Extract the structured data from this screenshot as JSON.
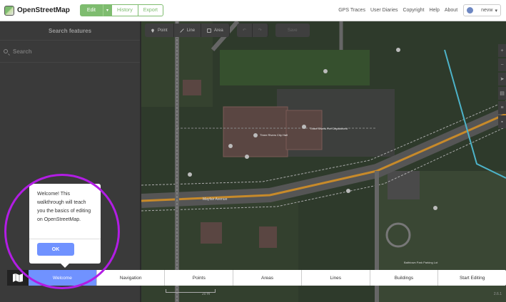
{
  "navbar": {
    "brand": "OpenStreetMap",
    "edit_label": "Edit",
    "history_label": "History",
    "export_label": "Export",
    "links": [
      "GPS Traces",
      "User Diaries",
      "Copyright",
      "Help",
      "About"
    ],
    "username": "nevw"
  },
  "sidebar": {
    "header": "Search features",
    "search_placeholder": "Search"
  },
  "toolbar": {
    "point_label": "Point",
    "line_label": "Line",
    "area_label": "Area",
    "save_label": "Save"
  },
  "map_labels": {
    "street": "Mayfair Avenue",
    "place1": "Three Rivers City Hall",
    "place2": "Three Rivers Fire Department",
    "park": "Bathtown Park Parking Lot"
  },
  "tooltip": {
    "text": "Welcome! This walkthrough will teach you the basics of editing on OpenStreetMap.",
    "ok_label": "OK"
  },
  "walkthrough": {
    "tabs": [
      {
        "label": "Welcome",
        "active": true
      },
      {
        "label": "Navigation",
        "active": false
      },
      {
        "label": "Points",
        "active": false
      },
      {
        "label": "Areas",
        "active": false
      },
      {
        "label": "Lines",
        "active": false
      },
      {
        "label": "Buildings",
        "active": false
      },
      {
        "label": "Start Editing",
        "active": false
      }
    ]
  },
  "footer": {
    "scale": "20 m",
    "version": "2.6.1"
  },
  "colors": {
    "accent": "#7ebc6f",
    "walkthrough_active": "#7092ff",
    "highlight_ring": "#b21de4",
    "road_major": "#c78a2a"
  }
}
